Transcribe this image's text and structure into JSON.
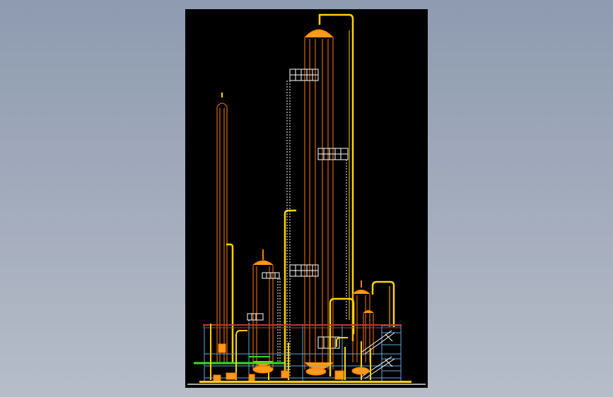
{
  "viewer": {
    "background_top": "#8e9bb0",
    "background_bottom": "#b6bdc9",
    "canvas_color": "#000000"
  },
  "drawing": {
    "subject": "process-plant-elevation",
    "colors": {
      "vessel": "#ff7a00",
      "vessel_fill": "#ff9a1a",
      "pipe": "#ffd400",
      "ladder": "#ffffff",
      "steel": "#5fa8d8",
      "deck": "#c0392b",
      "green_pipe": "#33dd22",
      "ground": "#dddddd"
    }
  }
}
